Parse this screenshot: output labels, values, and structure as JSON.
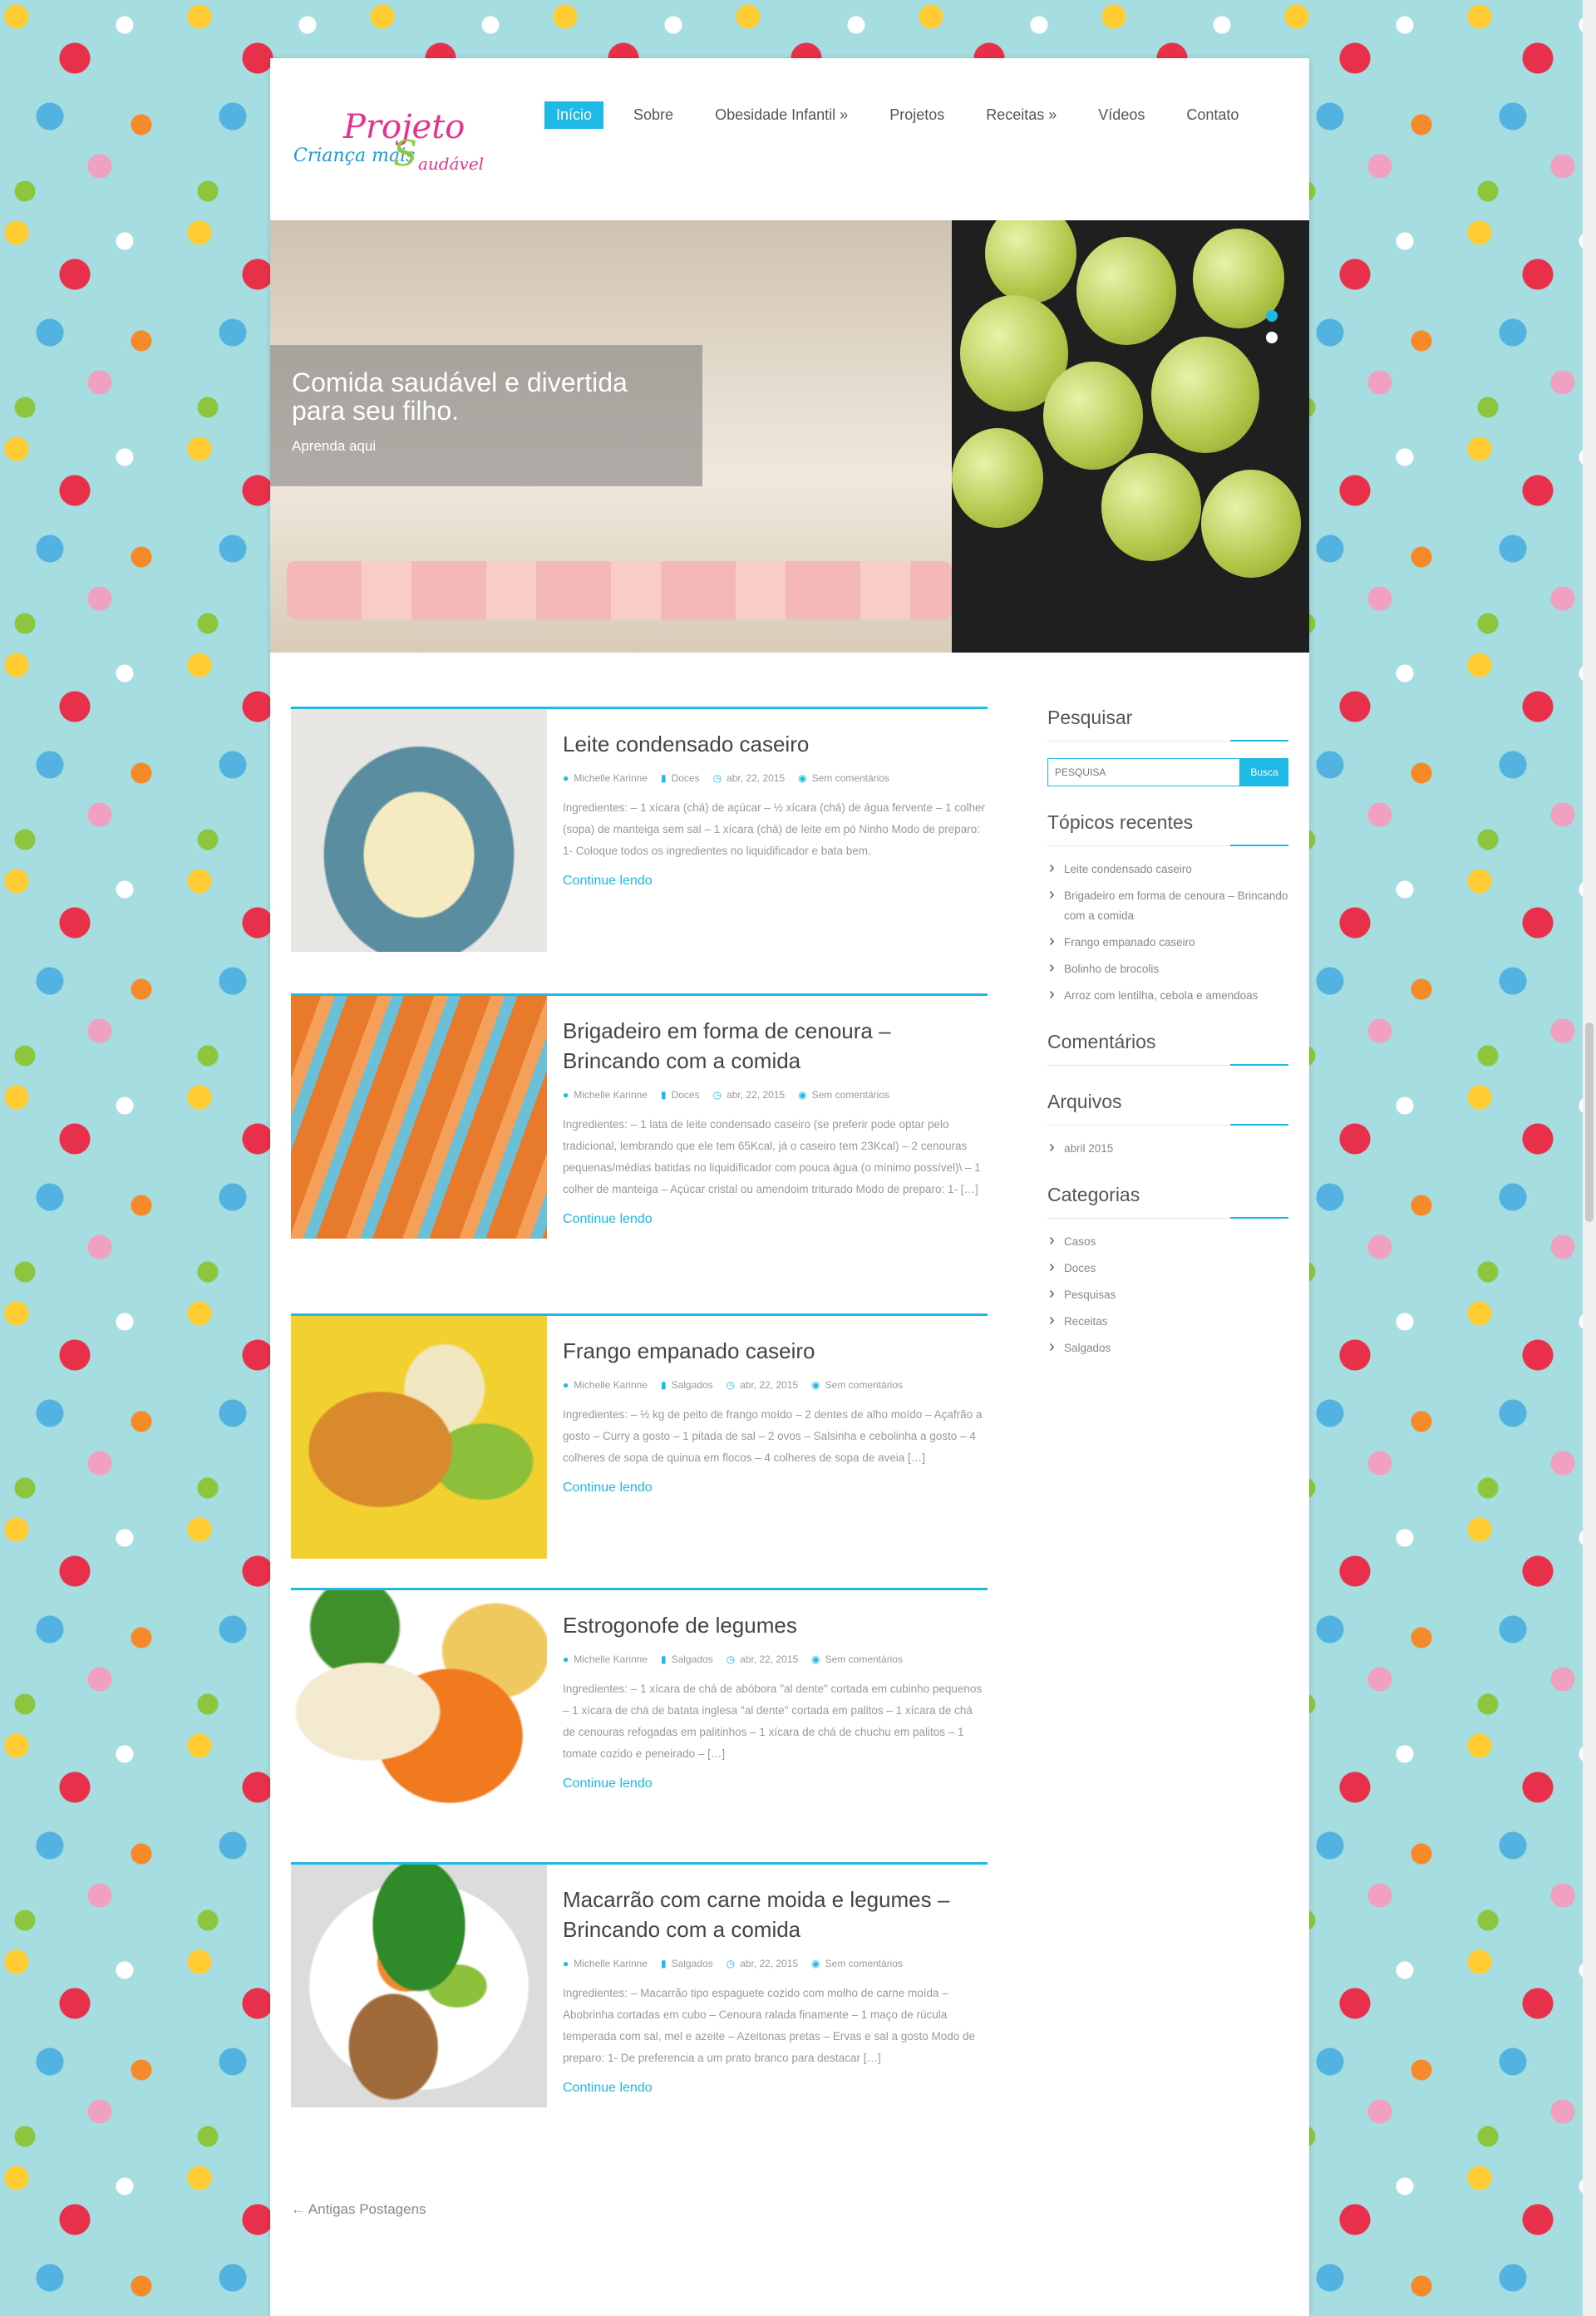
{
  "site": {
    "logo_text": {
      "p1": "Projeto",
      "p2": "Criança mais",
      "p3": "S",
      "p4": "audável"
    }
  },
  "nav": {
    "items": [
      "Início",
      "Sobre",
      "Obesidade Infantil »",
      "Projetos",
      "Receitas »",
      "Vídeos",
      "Contato"
    ],
    "active_index": 0
  },
  "slider": {
    "title": "Comida saudável e divertida para seu filho.",
    "subtitle": "Aprenda aqui",
    "slides": 2,
    "current": 1
  },
  "posts": [
    {
      "title": "Leite condensado caseiro",
      "author": "Michelle Karinne",
      "category": "Doces",
      "date": "abr, 22, 2015",
      "comments": "Sem comentários",
      "excerpt": "Ingredientes:  – 1 xícara (chá) de açúcar – ½ xícara (chá) de água fervente – 1 colher (sopa) de manteiga sem sal – 1 xícara (chá) de leite em pó Ninho   Modo de preparo: 1- Coloque todos os ingredientes no liquidificador e bata bem.",
      "more": "Continue lendo"
    },
    {
      "title": "Brigadeiro em forma de cenoura – Brincando com a comida",
      "author": "Michelle Karinne",
      "category": "Doces",
      "date": "abr, 22, 2015",
      "comments": "Sem comentários",
      "excerpt": "Ingredientes:  – 1 lata de leite condensado caseiro (se preferir pode optar pelo tradicional, lembrando que ele tem 65Kcal, já o caseiro tem 23Kcal) –  2 cenouras pequenas/médias batidas no liquidificador com pouca água (o mínimo possível)\\ – 1 colher de manteiga – Açúcar cristal ou amendoim triturado   Modo de preparo: 1- […]",
      "more": "Continue lendo"
    },
    {
      "title": "Frango empanado caseiro",
      "author": "Michelle Karinne",
      "category": "Salgados",
      "date": "abr, 22, 2015",
      "comments": "Sem comentários",
      "excerpt": "Ingredientes:  – ½ kg de peito de frango moído – 2 dentes de alho moído – Açafrão a gosto – Curry a gosto – 1 pitada de sal – 2 ovos – Salsinha e cebolinha a gosto – 4 colheres de sopa de quinua em flocos – 4 colheres de sopa de aveia […]",
      "more": "Continue lendo"
    },
    {
      "title": "Estrogonofe de legumes",
      "author": "Michelle Karinne",
      "category": "Salgados",
      "date": "abr, 22, 2015",
      "comments": "Sem comentários",
      "excerpt": "Ingredientes:  – 1 xícara de chá de abóbora  \"al dente\"  cortada em cubinho pequenos – 1 xícara de chá de batata inglesa \"al dente\"  cortada em palitos – 1 xícara de chá de cenouras refogadas em palitinhos – 1 xícara de chá de chuchu em palitos – 1 tomate cozido e peneirado – […]",
      "more": "Continue lendo"
    },
    {
      "title": "Macarrão com carne moida e legumes – Brincando com a comida",
      "author": "Michelle Karinne",
      "category": "Salgados",
      "date": "abr, 22, 2015",
      "comments": "Sem comentários",
      "excerpt": "Ingredientes: – Macarrão tipo espaguete cozido com molho de carne moída – Abobrinha cortadas em cubo – Cenoura ralada finamente – 1 maço de rúcula temperada com sal, mel e azeite – Azeitonas pretas – Ervas e sal a gosto   Modo de preparo: 1- De preferencia a um prato branco para destacar […]",
      "more": "Continue lendo"
    }
  ],
  "older_link": "← Antigas Postagens",
  "sidebar": {
    "search": {
      "title": "Pesquisar",
      "placeholder": "PESQUISA",
      "button": "Busca"
    },
    "recent": {
      "title": "Tópicos recentes",
      "items": [
        "Leite condensado caseiro",
        "Brigadeiro em forma de cenoura – Brincando com a comida",
        "Frango empanado caseiro",
        "Bolinho de brocolis",
        "Arroz com lentilha, cebola e amendoas"
      ]
    },
    "comments": {
      "title": "Comentários"
    },
    "archives": {
      "title": "Arquivos",
      "items": [
        "abril 2015"
      ]
    },
    "categories": {
      "title": "Categorias",
      "items": [
        "Casos",
        "Doces",
        "Pesquisas",
        "Receitas",
        "Salgados"
      ]
    }
  },
  "colors": {
    "accent": "#1fb9e6",
    "background": "#a6dde0"
  }
}
